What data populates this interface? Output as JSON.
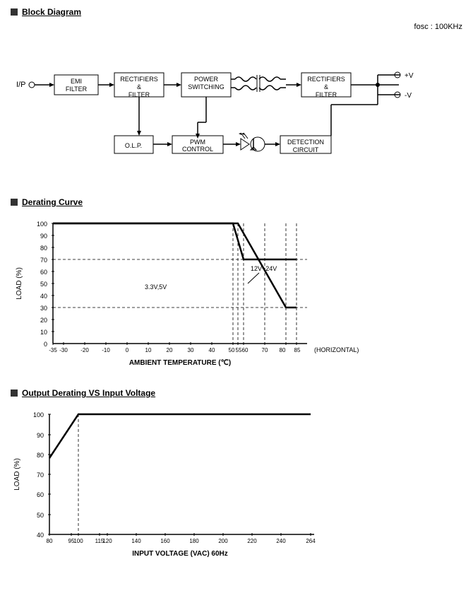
{
  "sections": {
    "block_diagram": {
      "title": "Block Diagram",
      "fosc": "fosc : 100KHz",
      "blocks": [
        {
          "id": "ip",
          "label": "I/P"
        },
        {
          "id": "emi",
          "label": "EMI\nFILTER"
        },
        {
          "id": "rect1",
          "label": "RECTIFIERS\n&\nFILTER"
        },
        {
          "id": "power",
          "label": "POWER\nSWITCHING"
        },
        {
          "id": "rect2",
          "label": "RECTIFIERS\n&\nFILTER"
        },
        {
          "id": "olp",
          "label": "O.L.P."
        },
        {
          "id": "pwm",
          "label": "PWM\nCONTROL"
        },
        {
          "id": "detection",
          "label": "DETECTION\nCIRCUIT"
        },
        {
          "id": "vplus",
          "label": "+V"
        },
        {
          "id": "vminus",
          "label": "-V"
        }
      ]
    },
    "derating_curve": {
      "title": "Derating Curve",
      "y_axis_label": "LOAD (%)",
      "x_axis_label": "AMBIENT TEMPERATURE (℃)",
      "x_axis_unit": "(HORIZONTAL)",
      "y_ticks": [
        0,
        10,
        20,
        30,
        40,
        50,
        60,
        70,
        80,
        90,
        100
      ],
      "x_ticks": [
        -35,
        -30,
        -20,
        -10,
        0,
        10,
        20,
        30,
        40,
        "50 55 60",
        70,
        "80 85"
      ],
      "series": [
        {
          "label": "3.3V,5V"
        },
        {
          "label": "12V~24V"
        }
      ]
    },
    "output_derating": {
      "title": "Output Derating VS Input Voltage",
      "y_axis_label": "LOAD (%)",
      "x_axis_label": "INPUT VOLTAGE (VAC) 60Hz",
      "y_ticks": [
        40,
        50,
        60,
        70,
        80,
        90,
        100
      ],
      "x_ticks": [
        80,
        95,
        100,
        115,
        120,
        140,
        160,
        180,
        200,
        220,
        240,
        264
      ]
    }
  }
}
